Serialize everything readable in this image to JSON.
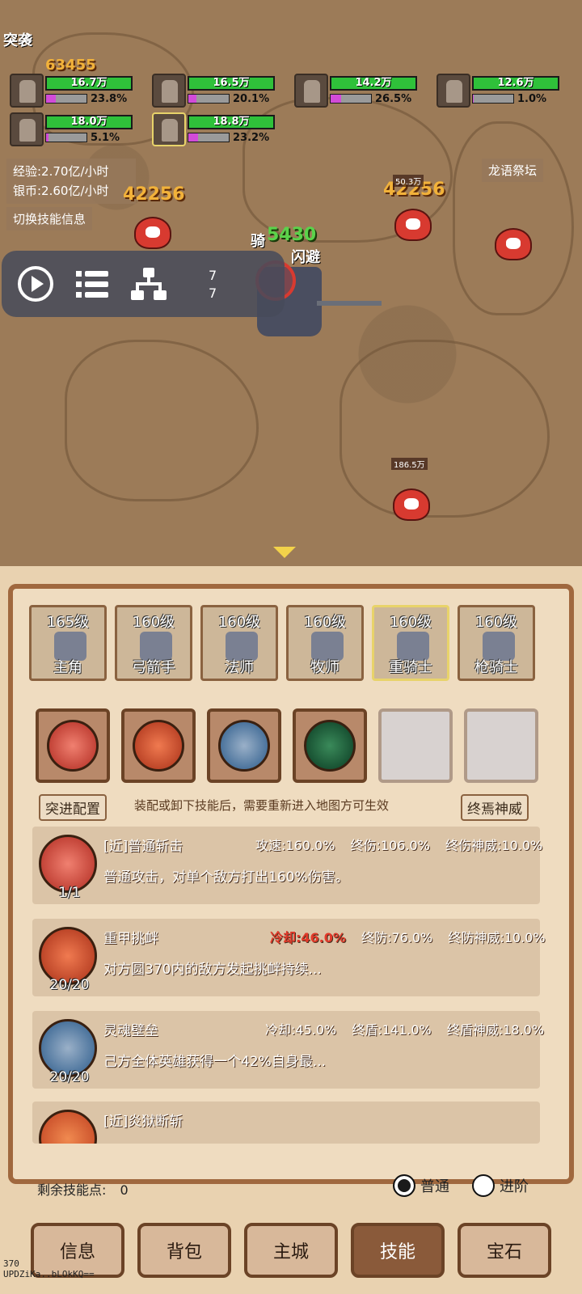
{
  "battle": {
    "party": [
      {
        "hp": "16.7万",
        "mp_pct_text": "23.8%",
        "mp_fill": 0.238
      },
      {
        "hp": "16.5万",
        "mp_pct_text": "20.1%",
        "mp_fill": 0.201
      },
      {
        "hp": "14.2万",
        "mp_pct_text": "26.5%",
        "mp_fill": 0.265
      },
      {
        "hp": "12.6万",
        "mp_pct_text": "1.0%",
        "mp_fill": 0.01
      },
      {
        "hp": "18.0万",
        "mp_pct_text": "5.1%",
        "mp_fill": 0.051
      },
      {
        "hp": "18.8万",
        "mp_pct_text": "23.2%",
        "mp_fill": 0.232
      }
    ],
    "exp_rate": "经验:2.70亿/小时",
    "coin_rate": "银币:2.60亿/小时",
    "switch_skill_info": "切换技能信息",
    "location": "龙语祭坛",
    "floating_damage": [
      "42256",
      "42256",
      "63455",
      "5430"
    ],
    "enemy_hp_labels": [
      "50.3万",
      "186.5万"
    ],
    "effect_text": "骑",
    "effect_text_2": "闪避",
    "raid_text": "突袭",
    "recorder_counter": [
      "7",
      "7"
    ]
  },
  "roles": [
    {
      "level": "165级",
      "name": "主角"
    },
    {
      "level": "160级",
      "name": "弓箭手"
    },
    {
      "level": "160级",
      "name": "法师"
    },
    {
      "level": "160级",
      "name": "牧师"
    },
    {
      "level": "160级",
      "name": "重骑士"
    },
    {
      "level": "160级",
      "name": "枪骑士"
    }
  ],
  "config": {
    "rush_config": "突进配置",
    "hint": "装配或卸下技能后，需要重新进入地图方可生效",
    "final_might": "终焉神威"
  },
  "skills": [
    {
      "name": "[近]普通斩击",
      "level": "1/1",
      "stats": [
        "攻速:160.0%",
        "终伤:106.0%",
        "终伤神威:10.0%"
      ],
      "desc": "普通攻击，对单个敌方打出160%伤害。"
    },
    {
      "name": "重甲挑衅",
      "level": "20/20",
      "stats": [
        "冷却:46.0%",
        "终防:76.0%",
        "终防神威:10.0%"
      ],
      "desc": "对方圆370内的敌方发起挑衅持续..."
    },
    {
      "name": "灵魂壁垒",
      "level": "20/20",
      "stats": [
        "冷却:45.0%",
        "终盾:141.0%",
        "终盾神威:18.0%"
      ],
      "desc": "己方全体英雄获得一个42%自身最..."
    },
    {
      "name": "[近]炎狱断斩",
      "level": "",
      "stats": [],
      "desc": ""
    }
  ],
  "footer": {
    "remaining_points_label": "剩余技能点:",
    "remaining_points_value": "0",
    "mode_normal": "普通",
    "mode_advanced": "进阶"
  },
  "tabs": [
    "信息",
    "背包",
    "主城",
    "技能",
    "宝石"
  ],
  "debug_text": [
    "370",
    "UPDZiKa..bLOkKQ=="
  ],
  "colors": {
    "hp_bar": "#2fc13a",
    "mp_bar": "#d24bd8",
    "cooldown_highlight": "#e23a2a",
    "frame": "#a0683e"
  }
}
